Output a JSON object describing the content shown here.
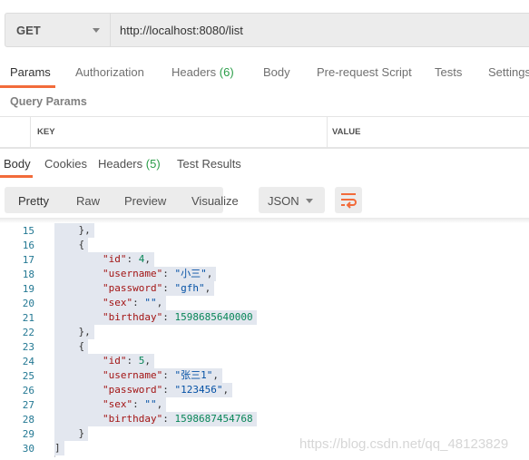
{
  "request": {
    "method": "GET",
    "url": "http://localhost:8080/list"
  },
  "request_tabs": [
    {
      "label": "Params"
    },
    {
      "label": "Authorization"
    },
    {
      "label": "Headers",
      "count": "(6)"
    },
    {
      "label": "Body"
    },
    {
      "label": "Pre-request Script"
    },
    {
      "label": "Tests"
    },
    {
      "label": "Settings"
    }
  ],
  "query_params": {
    "title": "Query Params",
    "columns": [
      "KEY",
      "VALUE"
    ]
  },
  "response_tabs": [
    {
      "label": "Body"
    },
    {
      "label": "Cookies"
    },
    {
      "label": "Headers",
      "count": "(5)"
    },
    {
      "label": "Test Results"
    }
  ],
  "format_buttons": [
    "Pretty",
    "Raw",
    "Preview",
    "Visualize"
  ],
  "format_select": "JSON",
  "colors": {
    "accent": "#f26b3a",
    "count": "#2a9d48",
    "key": "#a31515",
    "string": "#0451a5",
    "number": "#098658"
  },
  "code_lines": [
    {
      "n": "15",
      "tokens": [
        {
          "t": "    },",
          "c": "p"
        }
      ]
    },
    {
      "n": "16",
      "tokens": [
        {
          "t": "    {",
          "c": "p"
        }
      ]
    },
    {
      "n": "17",
      "tokens": [
        {
          "t": "        \"id\"",
          "c": "k"
        },
        {
          "t": ": ",
          "c": "p"
        },
        {
          "t": "4",
          "c": "n"
        },
        {
          "t": ",",
          "c": "p"
        }
      ]
    },
    {
      "n": "18",
      "tokens": [
        {
          "t": "        \"username\"",
          "c": "k"
        },
        {
          "t": ": ",
          "c": "p"
        },
        {
          "t": "\"小三\"",
          "c": "s"
        },
        {
          "t": ",",
          "c": "p"
        }
      ]
    },
    {
      "n": "19",
      "tokens": [
        {
          "t": "        \"password\"",
          "c": "k"
        },
        {
          "t": ": ",
          "c": "p"
        },
        {
          "t": "\"gfh\"",
          "c": "s"
        },
        {
          "t": ",",
          "c": "p"
        }
      ]
    },
    {
      "n": "20",
      "tokens": [
        {
          "t": "        \"sex\"",
          "c": "k"
        },
        {
          "t": ": ",
          "c": "p"
        },
        {
          "t": "\"\"",
          "c": "s"
        },
        {
          "t": ",",
          "c": "p"
        }
      ]
    },
    {
      "n": "21",
      "tokens": [
        {
          "t": "        \"birthday\"",
          "c": "k"
        },
        {
          "t": ": ",
          "c": "p"
        },
        {
          "t": "1598685640000",
          "c": "n"
        }
      ]
    },
    {
      "n": "22",
      "tokens": [
        {
          "t": "    },",
          "c": "p"
        }
      ]
    },
    {
      "n": "23",
      "tokens": [
        {
          "t": "    {",
          "c": "p"
        }
      ]
    },
    {
      "n": "24",
      "tokens": [
        {
          "t": "        \"id\"",
          "c": "k"
        },
        {
          "t": ": ",
          "c": "p"
        },
        {
          "t": "5",
          "c": "n"
        },
        {
          "t": ",",
          "c": "p"
        }
      ]
    },
    {
      "n": "25",
      "tokens": [
        {
          "t": "        \"username\"",
          "c": "k"
        },
        {
          "t": ": ",
          "c": "p"
        },
        {
          "t": "\"张三1\"",
          "c": "s"
        },
        {
          "t": ",",
          "c": "p"
        }
      ]
    },
    {
      "n": "26",
      "tokens": [
        {
          "t": "        \"password\"",
          "c": "k"
        },
        {
          "t": ": ",
          "c": "p"
        },
        {
          "t": "\"123456\"",
          "c": "s"
        },
        {
          "t": ",",
          "c": "p"
        }
      ]
    },
    {
      "n": "27",
      "tokens": [
        {
          "t": "        \"sex\"",
          "c": "k"
        },
        {
          "t": ": ",
          "c": "p"
        },
        {
          "t": "\"\"",
          "c": "s"
        },
        {
          "t": ",",
          "c": "p"
        }
      ]
    },
    {
      "n": "28",
      "tokens": [
        {
          "t": "        \"birthday\"",
          "c": "k"
        },
        {
          "t": ": ",
          "c": "p"
        },
        {
          "t": "1598687454768",
          "c": "n"
        }
      ]
    },
    {
      "n": "29",
      "tokens": [
        {
          "t": "    }",
          "c": "p"
        }
      ]
    },
    {
      "n": "30",
      "tokens": [
        {
          "t": "]",
          "c": "p"
        }
      ]
    }
  ],
  "watermark": "https://blog.csdn.net/qq_48123829"
}
